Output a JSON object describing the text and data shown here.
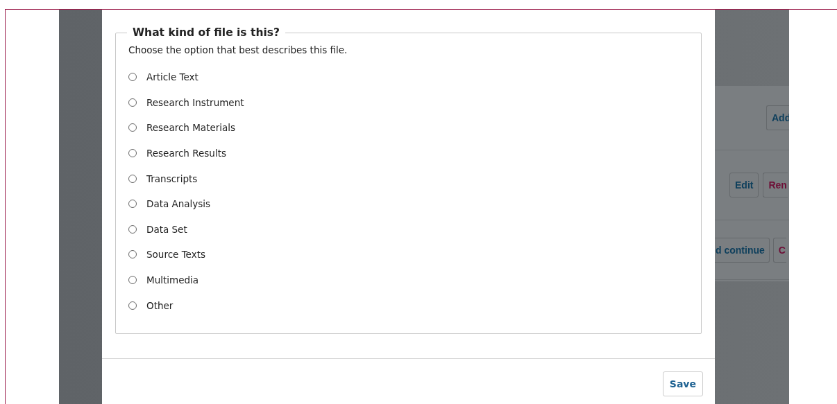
{
  "fieldset": {
    "legend": "What kind of file is this?",
    "description": "Choose the option that best describes this file.",
    "options": [
      {
        "label": "Article Text",
        "selected": false
      },
      {
        "label": "Research Instrument",
        "selected": false
      },
      {
        "label": "Research Materials",
        "selected": false
      },
      {
        "label": "Research Results",
        "selected": false
      },
      {
        "label": "Transcripts",
        "selected": false
      },
      {
        "label": "Data Analysis",
        "selected": false
      },
      {
        "label": "Data Set",
        "selected": false
      },
      {
        "label": "Source Texts",
        "selected": false
      },
      {
        "label": "Multimedia",
        "selected": false
      },
      {
        "label": "Other",
        "selected": false
      }
    ]
  },
  "footer": {
    "button": "Save"
  },
  "background_page": {
    "rows": [
      {
        "buttons": [
          {
            "label": "Add",
            "kind": "primary"
          }
        ]
      },
      {
        "buttons": [
          {
            "label": "Edit",
            "kind": "primary"
          },
          {
            "label": "Ren",
            "kind": "danger"
          }
        ]
      },
      {
        "buttons": [
          {
            "label": "d continue",
            "kind": "primary"
          },
          {
            "label": "C",
            "kind": "danger"
          }
        ]
      }
    ]
  }
}
